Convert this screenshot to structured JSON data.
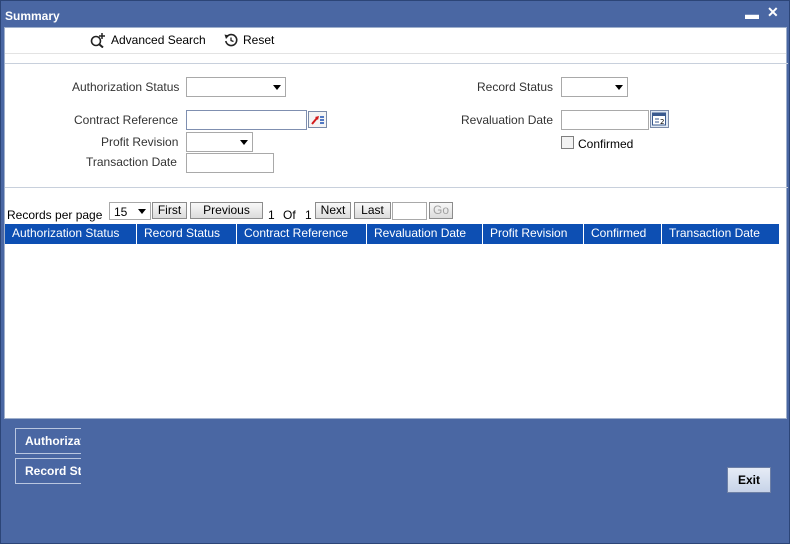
{
  "window": {
    "title": "Summary"
  },
  "icons": {
    "minimize": "minimize-icon",
    "close": "close-icon",
    "advanced_search": "search-plus-icon",
    "reset": "reset-icon",
    "lov": "list-of-values-icon",
    "calendar": "calendar-icon"
  },
  "toolbar": {
    "advanced_search_label": "Advanced Search",
    "reset_label": "Reset"
  },
  "form": {
    "authorization_status": {
      "label": "Authorization Status",
      "value": ""
    },
    "record_status": {
      "label": "Record Status",
      "value": ""
    },
    "contract_reference": {
      "label": "Contract Reference",
      "value": ""
    },
    "revaluation_date": {
      "label": "Revaluation Date",
      "value": ""
    },
    "profit_revision": {
      "label": "Profit Revision",
      "value": ""
    },
    "confirmed": {
      "label": "Confirmed",
      "checked": false
    },
    "transaction_date": {
      "label": "Transaction Date",
      "value": ""
    }
  },
  "pager": {
    "records_per_page_label": "Records per page",
    "records_per_page_value": "15",
    "first_label": "First",
    "previous_label": "Previous",
    "current_page": "1",
    "of_label": "Of",
    "total_pages": "1",
    "next_label": "Next",
    "last_label": "Last",
    "go_label": "Go",
    "page_input": ""
  },
  "grid": {
    "columns": [
      "Authorization Status",
      "Record Status",
      "Contract Reference",
      "Revaluation Date",
      "Profit Revision",
      "Confirmed",
      "Transaction Date"
    ],
    "rows": []
  },
  "footer": {
    "authorization_button": "Authorizat",
    "record_status_button": "Record St",
    "exit_label": "Exit"
  },
  "colors": {
    "frame": "#4a67a3",
    "grid_header": "#0d4fb3"
  }
}
